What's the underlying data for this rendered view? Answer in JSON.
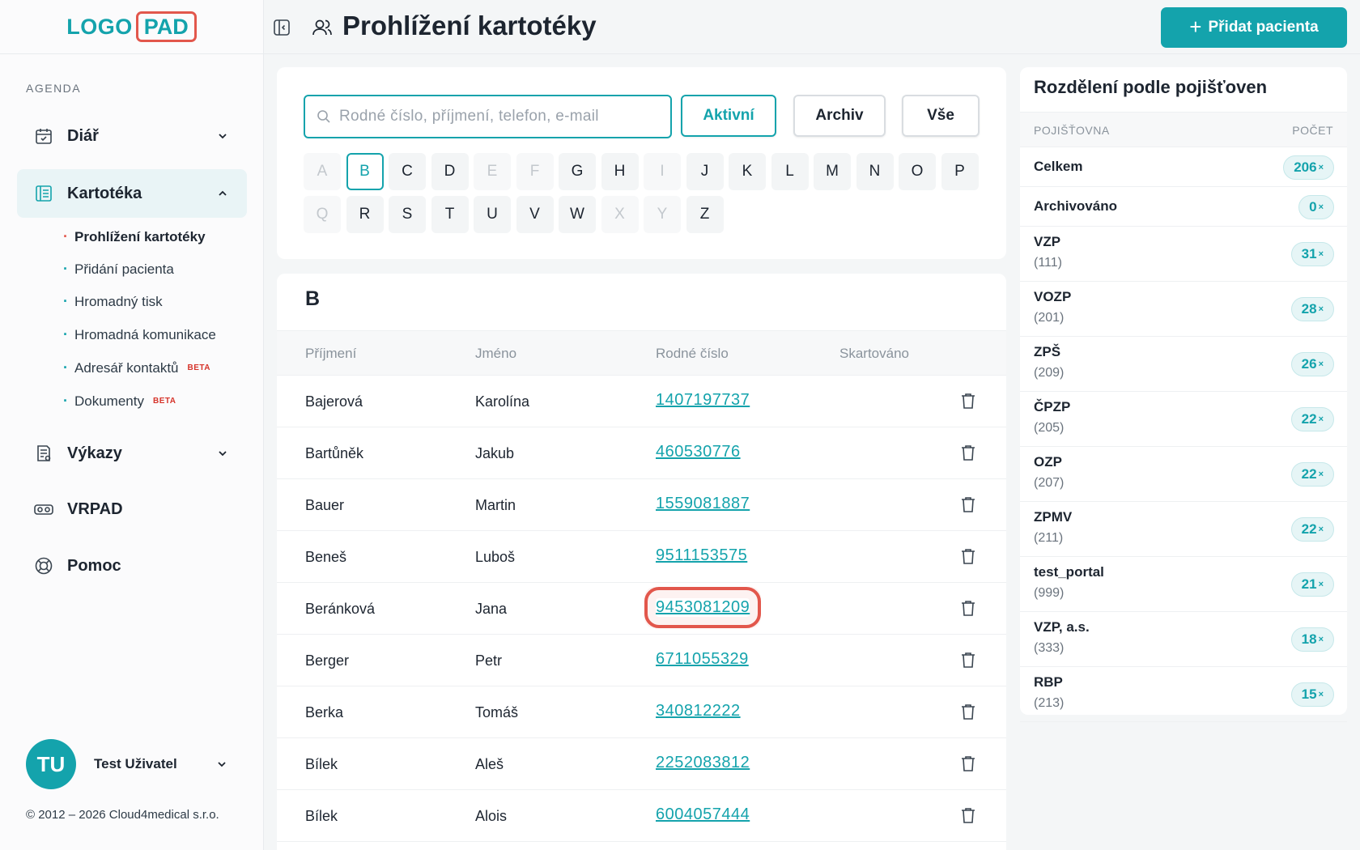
{
  "logo": {
    "part1": "LOGO",
    "part2": "PAD"
  },
  "sidebar": {
    "section_label": "AGENDA",
    "items": [
      {
        "label": "Diář",
        "icon": "calendar-icon"
      },
      {
        "label": "Kartotéka",
        "icon": "card-file-icon"
      },
      {
        "label": "Výkazy",
        "icon": "report-icon"
      },
      {
        "label": "VRPAD",
        "icon": "vr-headset-icon"
      },
      {
        "label": "Pomoc",
        "icon": "lifebuoy-icon"
      }
    ],
    "subitems": [
      {
        "label": "Prohlížení kartotéky",
        "beta": ""
      },
      {
        "label": "Přidání pacienta",
        "beta": ""
      },
      {
        "label": "Hromadný tisk",
        "beta": ""
      },
      {
        "label": "Hromadná komunikace",
        "beta": ""
      },
      {
        "label": "Adresář kontaktů",
        "beta": "BETA"
      },
      {
        "label": "Dokumenty",
        "beta": "BETA"
      }
    ],
    "user": {
      "initials": "TU",
      "name": "Test Uživatel"
    },
    "copyright": "© 2012 – 2026 Cloud4medical s.r.o."
  },
  "header": {
    "title": "Prohlížení kartotéky",
    "add_button": "Přidat pacienta"
  },
  "filter": {
    "search_placeholder": "Rodné číslo, příjmení, telefon, e-mail",
    "search_value": "",
    "buttons": [
      "Aktivní",
      "Archiv",
      "Vše"
    ],
    "active_button": "Aktivní",
    "letters": [
      {
        "l": "A",
        "enabled": false
      },
      {
        "l": "B",
        "enabled": true
      },
      {
        "l": "C",
        "enabled": true
      },
      {
        "l": "D",
        "enabled": true
      },
      {
        "l": "E",
        "enabled": false
      },
      {
        "l": "F",
        "enabled": false
      },
      {
        "l": "G",
        "enabled": true
      },
      {
        "l": "H",
        "enabled": true
      },
      {
        "l": "I",
        "enabled": false
      },
      {
        "l": "J",
        "enabled": true
      },
      {
        "l": "K",
        "enabled": true
      },
      {
        "l": "L",
        "enabled": true
      },
      {
        "l": "M",
        "enabled": true
      },
      {
        "l": "N",
        "enabled": true
      },
      {
        "l": "O",
        "enabled": true
      },
      {
        "l": "P",
        "enabled": true
      },
      {
        "l": "Q",
        "enabled": false
      },
      {
        "l": "R",
        "enabled": true
      },
      {
        "l": "S",
        "enabled": true
      },
      {
        "l": "T",
        "enabled": true
      },
      {
        "l": "U",
        "enabled": true
      },
      {
        "l": "V",
        "enabled": true
      },
      {
        "l": "W",
        "enabled": true
      },
      {
        "l": "X",
        "enabled": false
      },
      {
        "l": "Y",
        "enabled": false
      },
      {
        "l": "Z",
        "enabled": true
      }
    ],
    "selected_letter": "B"
  },
  "table": {
    "group_letter": "B",
    "columns": [
      "Příjmení",
      "Jméno",
      "Rodné číslo",
      "Skartováno"
    ],
    "rows": [
      {
        "surname": "Bajerová",
        "name": "Karolína",
        "id": "1407197737"
      },
      {
        "surname": "Bartůněk",
        "name": "Jakub",
        "id": "460530776"
      },
      {
        "surname": "Bauer",
        "name": "Martin",
        "id": "1559081887"
      },
      {
        "surname": "Beneš",
        "name": "Luboš",
        "id": "9511153575"
      },
      {
        "surname": "Beránková",
        "name": "Jana",
        "id": "9453081209"
      },
      {
        "surname": "Berger",
        "name": "Petr",
        "id": "6711055329"
      },
      {
        "surname": "Berka",
        "name": "Tomáš",
        "id": "340812222"
      },
      {
        "surname": "Bílek",
        "name": "Aleš",
        "id": "2252083812"
      },
      {
        "surname": "Bílek",
        "name": "Alois",
        "id": "6004057444"
      }
    ],
    "highlighted_id": "9453081209"
  },
  "insurance": {
    "title": "Rozdělení podle pojišťoven",
    "col_name": "POJIŠŤOVNA",
    "col_count": "POČET",
    "rows": [
      {
        "name": "Celkem",
        "code": "",
        "count": "206"
      },
      {
        "name": "Archivováno",
        "code": "",
        "count": "0"
      },
      {
        "name": "VZP",
        "code": "(111)",
        "count": "31"
      },
      {
        "name": "VOZP",
        "code": "(201)",
        "count": "28"
      },
      {
        "name": "ZPŠ",
        "code": "(209)",
        "count": "26"
      },
      {
        "name": "ČPZP",
        "code": "(205)",
        "count": "22"
      },
      {
        "name": "OZP",
        "code": "(207)",
        "count": "22"
      },
      {
        "name": "ZPMV",
        "code": "(211)",
        "count": "22"
      },
      {
        "name": "test_portal",
        "code": "(999)",
        "count": "21"
      },
      {
        "name": "VZP, a.s.",
        "code": "(333)",
        "count": "18"
      },
      {
        "name": "RBP",
        "code": "(213)",
        "count": "15"
      }
    ],
    "count_suffix": "×"
  },
  "colors": {
    "accent": "#14a3ac",
    "highlight": "#e2574c",
    "text": "#1d2530"
  }
}
